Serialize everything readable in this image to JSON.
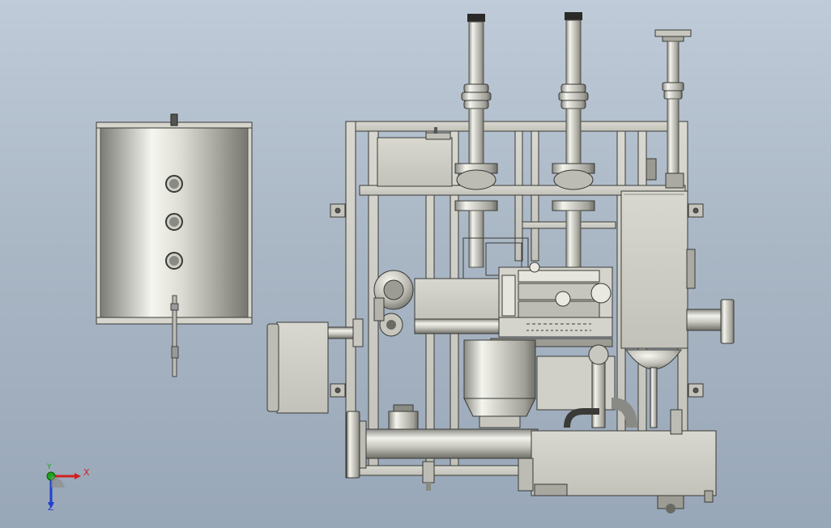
{
  "viewport": {
    "background_top": "#bfcbd8",
    "background_bottom": "#98a7b8"
  },
  "triad": {
    "x_label": "X",
    "y_label": "Y",
    "z_label": "Z",
    "x_color": "#d42020",
    "y_color": "#1fa11f",
    "z_color": "#2040d0"
  },
  "model": {
    "metal_light": "#e9e9e3",
    "metal_mid": "#b9b9b1",
    "metal_dark": "#6f6f69",
    "outline": "#3a3a36"
  }
}
